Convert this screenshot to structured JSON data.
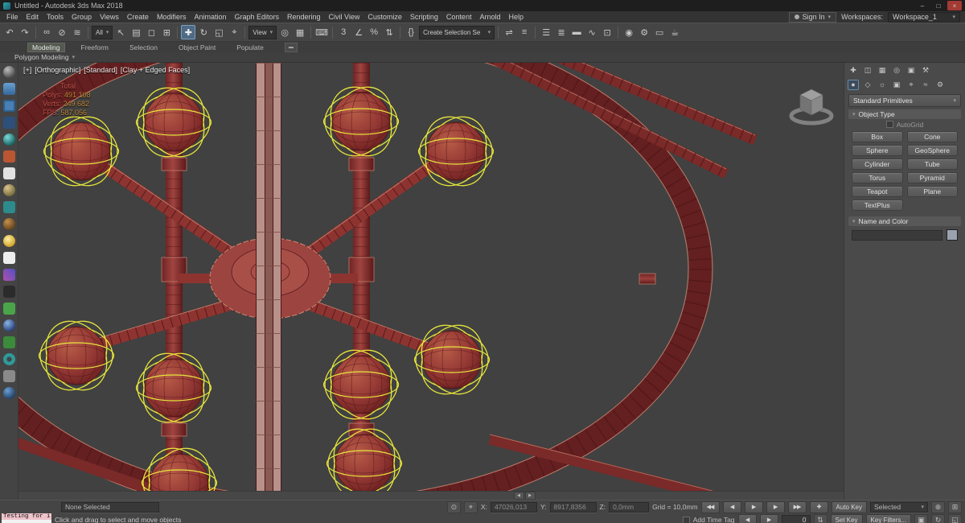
{
  "colors": {
    "selection_highlight": "#e6e63c",
    "model_red": "#8e3430",
    "viewport_bg": "#414141",
    "stats_label": "#c4524a",
    "stats_value": "#c08838"
  },
  "window": {
    "title": "Untitled - Autodesk 3ds Max 2018",
    "minimize": "–",
    "maximize": "□",
    "close": "×"
  },
  "menubar": {
    "items": [
      "File",
      "Edit",
      "Tools",
      "Group",
      "Views",
      "Create",
      "Modifiers",
      "Animation",
      "Graph Editors",
      "Rendering",
      "Civil View",
      "Customize",
      "Scripting",
      "Content",
      "Arnold",
      "Help"
    ],
    "sign_in": "Sign In",
    "workspaces_label": "Workspaces:",
    "workspace_value": "Workspace_1"
  },
  "icons": {
    "caret": "▾",
    "rollout": "▾",
    "undo": "↶",
    "redo": "↷",
    "link": "∞",
    "unlink": "⊘",
    "bind": "≋",
    "select": "↖",
    "select_by_name": "▤",
    "region": "◻",
    "window_crossing": "⊞",
    "move": "✚",
    "rotate": "↻",
    "scale": "◱",
    "placement": "⌖",
    "pivot": "◎",
    "manipulate": "▦",
    "keyboard": "⌨",
    "snap": "3",
    "angle_snap": "∠",
    "percent_snap": "%",
    "spinner_snap": "⇅",
    "edit_sets": "{}",
    "mirror": "⇌",
    "align": "≡",
    "explorer": "☰",
    "layers": "≣",
    "ribbon_toggle": "▬",
    "curve_editor": "∿",
    "schematic": "⊡",
    "material": "◉",
    "render_setup": "⚙",
    "rfw": "▭",
    "render": "☕",
    "create_tab": "✚",
    "modify_tab": "◫",
    "hierarchy_tab": "▦",
    "motion_tab": "◎",
    "display_tab": "▣",
    "utilities_tab": "⚒",
    "geometry": "●",
    "shapes": "◇",
    "lights": "☼",
    "cameras": "▣",
    "helpers": "⌖",
    "spacewarps": "≈",
    "systems": "⚙",
    "lock": "⊙",
    "gizmo": "⌖",
    "rew": "◀◀",
    "prev": "◀",
    "play": "▶",
    "next": "▶",
    "fwd": "▶▶",
    "key_mode": "✚",
    "spin": "⇅",
    "track_prev": "◀",
    "track_next": "▶",
    "zoom": "⊕",
    "zoom_all": "⊞",
    "pan": "▣",
    "orbit": "↻",
    "maximize": "◱"
  },
  "toolbar": {
    "selection_filter": "All",
    "coord_system": "View",
    "named_selection": "Create Selection Se"
  },
  "ribbon": {
    "tabs": [
      {
        "label": "Modeling"
      },
      {
        "label": "Freeform"
      },
      {
        "label": "Selection"
      },
      {
        "label": "Object Paint"
      },
      {
        "label": "Populate"
      }
    ],
    "subtab": "Polygon Modeling"
  },
  "viewport": {
    "label_segments": [
      "[+]",
      "[Orthographic]",
      "[Standard]",
      "[Clay + Edged Faces]"
    ],
    "stats": {
      "total_label": "Total",
      "polys_label": "Polys:",
      "polys_value": "491 108",
      "verts_label": "Verts:",
      "verts_value": "249 682",
      "fps_label": "FPS:",
      "fps_value": "587,056"
    }
  },
  "command_panel": {
    "category_dropdown": "Standard Primitives",
    "object_type_header": "Object Type",
    "autogrid_label": "AutoGrid",
    "primitive_buttons": [
      "Box",
      "Cone",
      "Sphere",
      "GeoSphere",
      "Cylinder",
      "Tube",
      "Torus",
      "Pyramid",
      "Teapot",
      "Plane",
      "TextPlus"
    ],
    "name_color_header": "Name and Color"
  },
  "status_bar": {
    "listener_text": "Testing for i",
    "selection_status": "None Selected",
    "prompt": "Click and drag to select and move objects",
    "x_label": "X:",
    "x_value": "47026,013",
    "y_label": "Y:",
    "y_value": "8917,8356",
    "z_label": "Z:",
    "z_value": "0,0mm",
    "grid_label": "Grid = 10,0mm",
    "add_time_tag": "Add Time Tag",
    "frame_value": "0",
    "auto_key": "Auto Key",
    "set_key": "Set Key",
    "selected": "Selected",
    "key_filters": "Key Filters..."
  }
}
